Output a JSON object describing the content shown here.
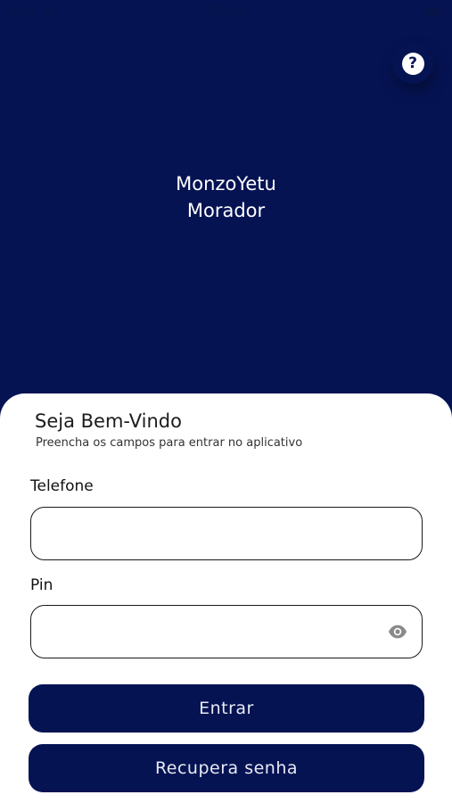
{
  "status_bar": {
    "carrier": "Rede",
    "time": "01:42",
    "wifi_icon": "wifi-icon",
    "battery_icon": "battery-icon"
  },
  "header": {
    "help_icon": "help-icon",
    "help_glyph": "?",
    "app_name": "MonzoYetu",
    "app_subtitle": "Morador"
  },
  "login": {
    "title": "Seja Bem-Vindo",
    "subtitle": "Preencha os campos para entrar no aplicativo",
    "phone_label": "Telefone",
    "phone_value": "",
    "phone_placeholder": "",
    "pin_label": "Pin",
    "pin_value": "",
    "pin_placeholder": "",
    "show_pin_icon": "eye-icon",
    "submit_label": "Entrar",
    "recover_label": "Recupera senha"
  },
  "colors": {
    "primary": "#051353",
    "surface": "#ffffff",
    "text": "#1c1c1c",
    "icon_muted": "#8a8a8a"
  }
}
